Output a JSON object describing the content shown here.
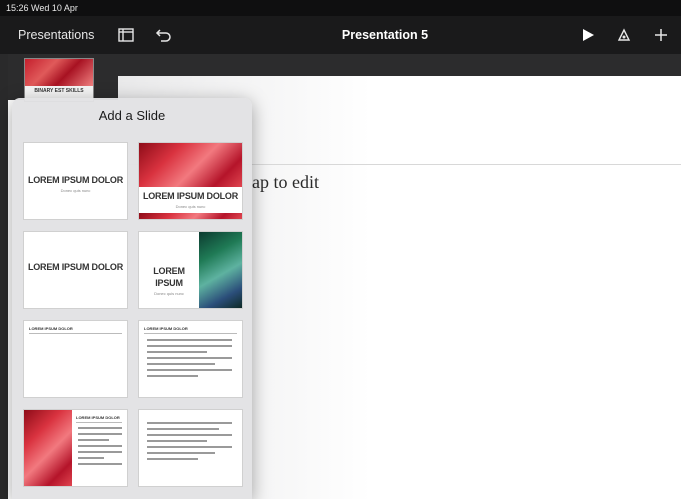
{
  "status_bar": {
    "time_date": "15:26  Wed 10 Apr"
  },
  "toolbar": {
    "presentations_label": "Presentations",
    "document_title": "Presentation 5",
    "icons": [
      "sidebar-layout-icon",
      "undo-icon",
      "play-icon",
      "format-brush-icon",
      "add-icon"
    ]
  },
  "slide_navigator": {
    "thumb_title": "BINARY EST SKILLS"
  },
  "canvas": {
    "placeholder_text": "ap to edit"
  },
  "add_slide_panel": {
    "title": "Add a Slide",
    "layouts": [
      {
        "title": "LOREM IPSUM DOLOR",
        "subtitle": "Donec quis nunc"
      },
      {
        "title": "LOREM IPSUM DOLOR",
        "subtitle": "Donec quis nunc"
      },
      {
        "title": "LOREM IPSUM DOLOR",
        "subtitle": ""
      },
      {
        "title_line1": "LOREM",
        "title_line2": "IPSUM",
        "subtitle": "Donec quis nunc"
      },
      {
        "title": "LOREM IPSUM DOLOR"
      },
      {
        "title": "LOREM IPSUM DOLOR"
      },
      {
        "title": "LOREM IPSUM DOLOR"
      },
      {
        "title": ""
      }
    ]
  }
}
